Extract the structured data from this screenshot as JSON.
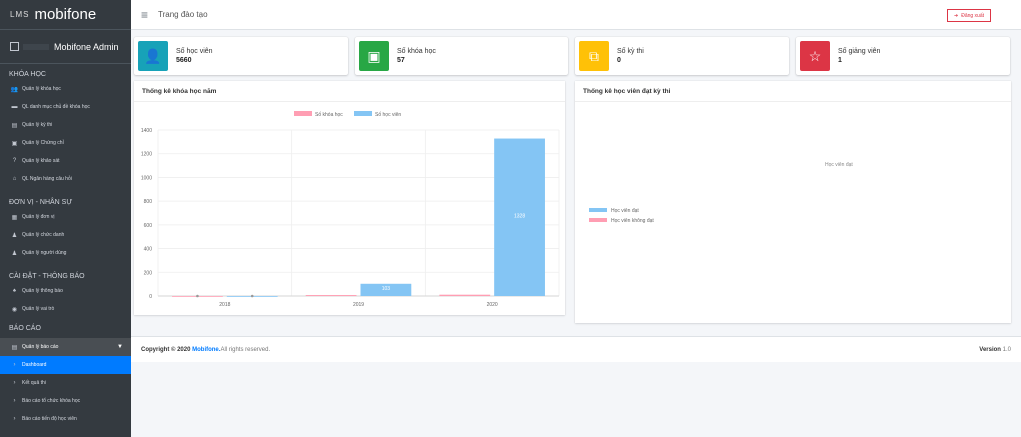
{
  "brand": {
    "lms": "LMS",
    "name": "mobifone"
  },
  "user": {
    "name": "Mobifone Admin"
  },
  "sidebar": {
    "sections": [
      {
        "header": "KHÓA HỌC",
        "items": [
          {
            "icon": "users-icon",
            "glyph": "👥",
            "label": "Quản lý khóa học"
          },
          {
            "icon": "folder-icon",
            "glyph": "▬",
            "label": "QL danh mục chủ đề khóa học"
          },
          {
            "icon": "calendar-icon",
            "glyph": "▤",
            "label": "Quản lý kỳ thi"
          },
          {
            "icon": "certificate-icon",
            "glyph": "▣",
            "label": "Quản lý Chứng chỉ"
          },
          {
            "icon": "question-icon",
            "glyph": "?",
            "label": "Quản lý khảo sát"
          },
          {
            "icon": "bank-icon",
            "glyph": "⌂",
            "label": "QL Ngân hàng câu hỏi"
          }
        ]
      },
      {
        "header": "ĐƠN VỊ - NHÂN SỰ",
        "items": [
          {
            "icon": "building-icon",
            "glyph": "▦",
            "label": "Quản lý đơn vị"
          },
          {
            "icon": "user-tie-icon",
            "glyph": "♟",
            "label": "Quản lý chức danh"
          },
          {
            "icon": "user-icon",
            "glyph": "♟",
            "label": "Quản lý người dùng"
          }
        ]
      },
      {
        "header": "CÀI ĐẶT - THÔNG BÁO",
        "items": [
          {
            "icon": "bell-icon",
            "glyph": "♠",
            "label": "Quản lý thông báo"
          },
          {
            "icon": "roles-icon",
            "glyph": "◉",
            "label": "Quản lý vai trò"
          }
        ]
      }
    ],
    "report_header": "BÁO CÁO",
    "report_group": {
      "icon": "report-icon",
      "glyph": "▤",
      "label": "Quản lý báo cáo"
    },
    "report_items": [
      {
        "label": "Dashboard",
        "active": true
      },
      {
        "label": "Kết quả thi",
        "active": false
      },
      {
        "label": "Báo cáo tổ chức khóa học",
        "active": false
      },
      {
        "label": "Báo cáo tiến độ học viên",
        "active": false
      }
    ]
  },
  "topbar": {
    "breadcrumb": "Trang đào tạo",
    "logout": "Đăng xuất"
  },
  "stats": [
    {
      "label": "Số học viên",
      "value": "5660",
      "color": "#17a2b8",
      "icon": "user-icon",
      "glyph": "👤"
    },
    {
      "label": "Số khóa học",
      "value": "57",
      "color": "#28a745",
      "icon": "book-icon",
      "glyph": "▣"
    },
    {
      "label": "Số kỳ thi",
      "value": "0",
      "color": "#ffc107",
      "icon": "copy-icon",
      "glyph": "⧉"
    },
    {
      "label": "Số giảng viên",
      "value": "1",
      "color": "#dc3545",
      "icon": "star-icon",
      "glyph": "☆"
    }
  ],
  "chart_left_title": "Thống kê khóa học năm",
  "chart_right_title": "Thống kê học viên đạt kỳ thi",
  "chart_data": [
    {
      "type": "bar",
      "categories": [
        "2018",
        "2019",
        "2020"
      ],
      "series": [
        {
          "name": "Số khóa học",
          "values": [
            0,
            8,
            11
          ],
          "color": "#ff9eb3"
        },
        {
          "name": "Số học viên",
          "values": [
            0,
            103,
            1328
          ],
          "color": "#84c5f4"
        }
      ],
      "data_labels": [
        "",
        "103",
        "1328"
      ],
      "yticks": [
        0,
        200,
        400,
        600,
        800,
        1000,
        1200,
        1400
      ],
      "ylim": [
        0,
        1400
      ],
      "legend": "top"
    },
    {
      "type": "pie",
      "labels": [
        "Học viên đạt",
        "Học viên không đạt"
      ],
      "values": [
        0,
        0
      ],
      "colors": [
        "#84c5f4",
        "#ff9eb3"
      ],
      "overlay_text": "Học viên đạt",
      "legend": "left"
    }
  ],
  "footer": {
    "copyright_prefix": "Copyright © 2020",
    "brand": "Mobifone.",
    "rights": " All rights reserved.",
    "version_label": "Version",
    "version": " 1.0"
  }
}
